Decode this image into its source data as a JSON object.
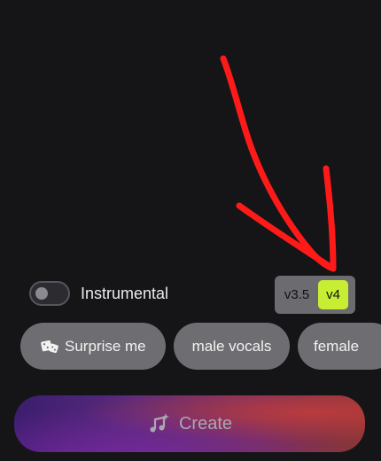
{
  "instrumental": {
    "label": "Instrumental",
    "enabled": false
  },
  "version_switch": {
    "options": [
      "v3.5",
      "v4"
    ],
    "selected": "v4"
  },
  "chips": [
    {
      "label": "Surprise me",
      "icon": "dice-icon"
    },
    {
      "label": "male vocals"
    },
    {
      "label": "female"
    }
  ],
  "create_button": {
    "label": "Create",
    "icon": "music-sparkle-icon"
  },
  "colors": {
    "background": "#151518",
    "selected_version": "#c8ee34",
    "chip": "#6e6e72",
    "annotation_arrow": "#ff1a1a"
  }
}
